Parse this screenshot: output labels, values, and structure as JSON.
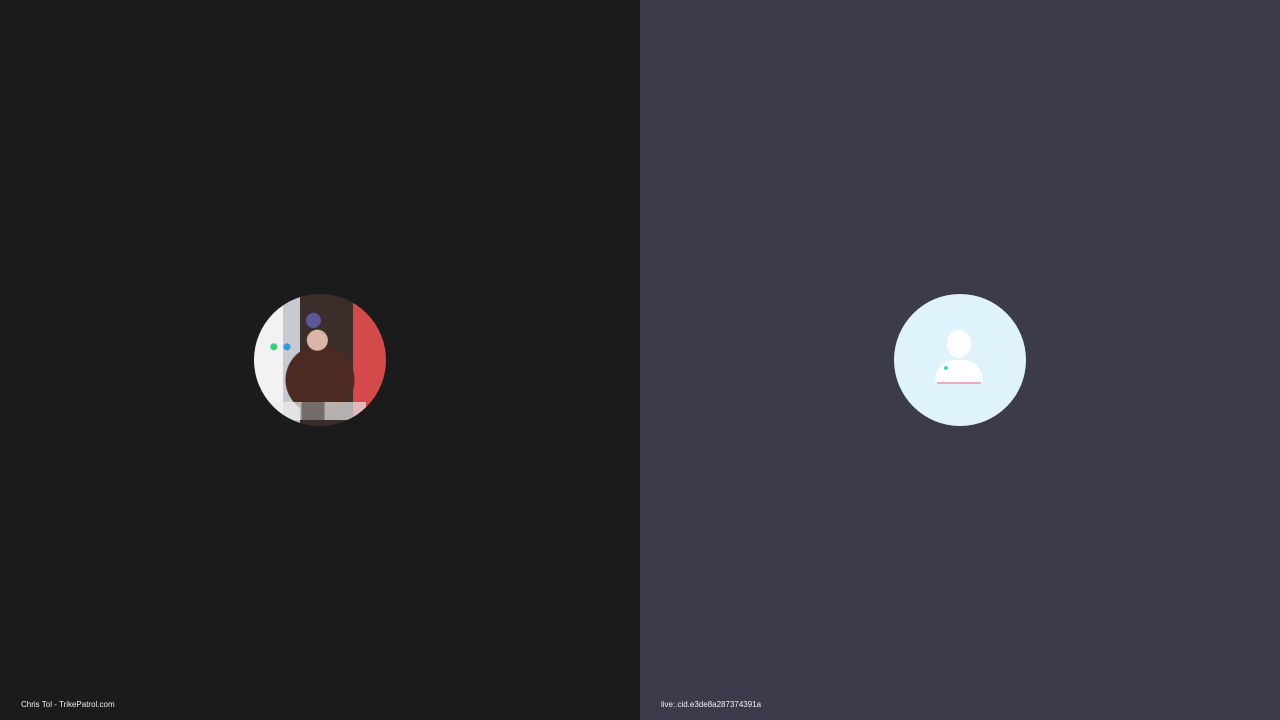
{
  "participants": [
    {
      "name_label": "Chris Tol - TrikePatrol.com",
      "avatar": "video-photo",
      "tile_color": "#1b1b1c"
    },
    {
      "name_label": "live:.cid.e3de8a287374391a",
      "avatar": "default-user-icon",
      "tile_color": "#3c3b4b",
      "avatar_bg": "#dff3fd"
    }
  ]
}
